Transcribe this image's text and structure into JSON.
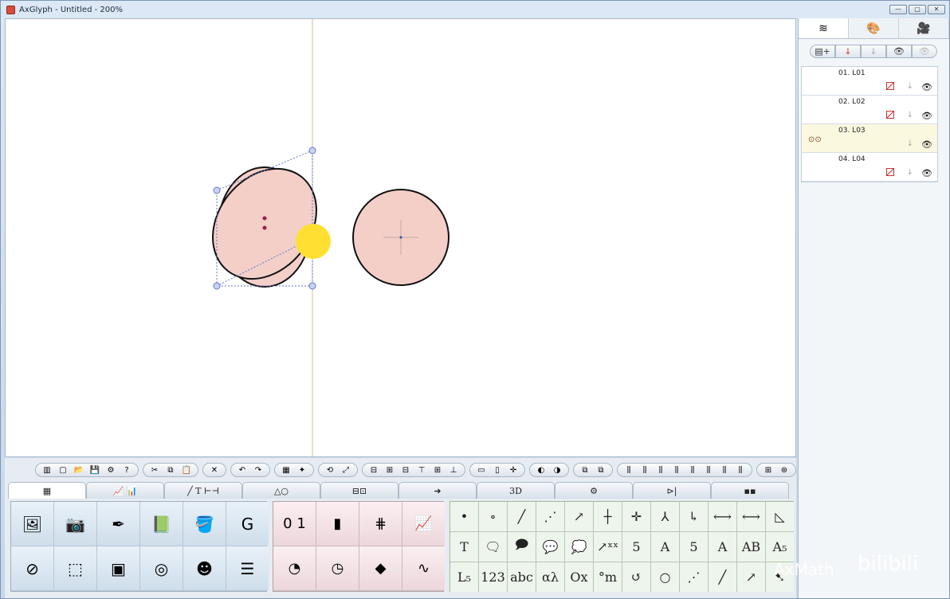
{
  "window": {
    "title": "AxGlyph - Untitled - 200%",
    "controls": [
      "—",
      "▢",
      "✕"
    ]
  },
  "colors": {
    "shape_fill": "#f3cfc8",
    "shape_stroke": "#111111",
    "highlight": "#ffe032",
    "guide": "#c2b9a0",
    "handle": "#7f8fd6"
  },
  "right_panel": {
    "tabs": [
      {
        "icon": "layers-icon",
        "glyph": "≋"
      },
      {
        "icon": "palette-icon",
        "glyph": "🎨"
      },
      {
        "icon": "camera-icon",
        "glyph": "🎥"
      }
    ],
    "layer_toolbar": [
      {
        "icon": "add-layer-icon",
        "glyph": "▤+"
      },
      {
        "icon": "move-down-icon",
        "glyph": "↓"
      },
      {
        "icon": "move-down-disabled-icon",
        "glyph": "↓"
      },
      {
        "icon": "show-icon",
        "glyph": "👁"
      },
      {
        "icon": "hide-icon",
        "glyph": "👁"
      }
    ],
    "layers": [
      {
        "name": "01. L01",
        "selected": false,
        "has_thumb": false
      },
      {
        "name": "02. L02",
        "selected": false,
        "has_thumb": false
      },
      {
        "name": "03. L03",
        "selected": true,
        "has_thumb": true,
        "thumb": "⊙⊙"
      },
      {
        "name": "04. L04",
        "selected": false,
        "has_thumb": false
      }
    ]
  },
  "toolbar_groups": [
    [
      "▥",
      "▢",
      "📂",
      "💾",
      "⚙",
      "?"
    ],
    [
      "✂",
      "⧉",
      "📋"
    ],
    [
      "✕"
    ],
    [
      "↶",
      "↷"
    ],
    [
      "▦",
      "✦"
    ],
    [
      "⟲",
      "⤢"
    ],
    [
      "⊟",
      "⊞",
      "⊟",
      "⊤",
      "⊞",
      "⊥"
    ],
    [
      "▭",
      "▯",
      "✛"
    ],
    [
      "◐",
      "◑"
    ],
    [
      "⧉",
      "⧉"
    ],
    [
      "⫼",
      "⫼",
      "⫼",
      "⫼",
      "⫼",
      "⫼",
      "⫼",
      "⫼"
    ],
    [
      "⊞",
      "⊛"
    ]
  ],
  "category_tabs": [
    {
      "label": "▦",
      "active": true
    },
    {
      "label": "📈 📊",
      "active": false
    },
    {
      "label": "╱ T ⊢⊣",
      "active": false
    },
    {
      "label": "△○",
      "active": false
    },
    {
      "label": "⊟⊡",
      "active": false
    },
    {
      "label": "➜",
      "active": false
    },
    {
      "label": "3D",
      "active": false
    },
    {
      "label": "⚙",
      "active": false
    },
    {
      "label": "⊳|",
      "active": false
    },
    {
      "label": "▪▪",
      "active": false
    }
  ],
  "tools_left": [
    {
      "icon": "image-icon",
      "glyph": "🖼"
    },
    {
      "icon": "screenshot-icon",
      "glyph": "📷"
    },
    {
      "icon": "pen-nib-icon",
      "glyph": "✒"
    },
    {
      "icon": "book-icon",
      "glyph": "📗"
    },
    {
      "icon": "paint-bucket-icon",
      "glyph": "🪣"
    },
    {
      "icon": "g-stamp-icon",
      "glyph": "G"
    },
    {
      "icon": "circle-cut-icon",
      "glyph": "⊘"
    },
    {
      "icon": "bounding-box-icon",
      "glyph": "⬚"
    },
    {
      "icon": "select-region-icon",
      "glyph": "▣"
    },
    {
      "icon": "ring-icon",
      "glyph": "◎"
    },
    {
      "icon": "head-gear-icon",
      "glyph": "☻"
    },
    {
      "icon": "list-tree-icon",
      "glyph": "☰"
    }
  ],
  "tools_mid": [
    {
      "icon": "ruler-icon",
      "glyph": "0 1"
    },
    {
      "icon": "colorbar-icon",
      "glyph": "▮"
    },
    {
      "icon": "grid-plot-icon",
      "glyph": "⋕"
    },
    {
      "icon": "area-chart-icon",
      "glyph": "📈"
    },
    {
      "icon": "pie-chart-icon",
      "glyph": "◔"
    },
    {
      "icon": "gauge-icon",
      "glyph": "◷"
    },
    {
      "icon": "surface-plot-icon",
      "glyph": "◆"
    },
    {
      "icon": "spiral-icon",
      "glyph": "∿"
    }
  ],
  "tools_right": [
    "•",
    "∘",
    "╱",
    "⋰",
    "↗",
    "┼",
    "✛",
    "⅄",
    "↳",
    "⟷",
    "⟷",
    "◺",
    "T",
    "🗨",
    "🗩",
    "💬",
    "💭",
    "↗ˣˣ",
    "5",
    "A",
    "5",
    "A",
    "AB",
    "A₅",
    "L₅",
    "123",
    "abc",
    "αλ",
    "Ox",
    "°m",
    "↺",
    "○",
    "⋰",
    "╱",
    "↗",
    "➷"
  ],
  "watermark": {
    "left_text": "AxMath",
    "right_text": "bilibili"
  }
}
